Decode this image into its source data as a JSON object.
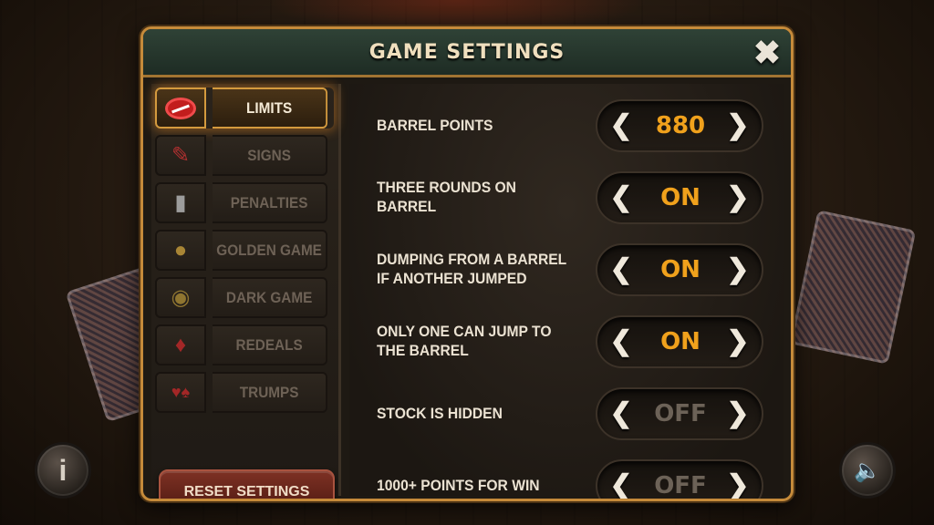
{
  "dialog": {
    "title": "GAME SETTINGS"
  },
  "sidebar": {
    "items": [
      {
        "label": "LIMITS",
        "icon": "no-entry-icon",
        "active": true
      },
      {
        "label": "SIGNS",
        "icon": "pen-icon",
        "active": false
      },
      {
        "label": "PENALTIES",
        "icon": "whistle-icon",
        "active": false
      },
      {
        "label": "GOLDEN GAME",
        "icon": "golden-chicken-icon",
        "active": false
      },
      {
        "label": "DARK GAME",
        "icon": "mask-icon",
        "active": false
      },
      {
        "label": "REDEALS",
        "icon": "cards-icon",
        "active": false
      },
      {
        "label": "TRUMPS",
        "icon": "card-suits-icon",
        "active": false
      }
    ],
    "reset_label": "RESET SETTINGS"
  },
  "settings": [
    {
      "label": "BARREL POINTS",
      "value": "880",
      "state": "on"
    },
    {
      "label": "THREE ROUNDS ON BARREL",
      "value": "ON",
      "state": "on"
    },
    {
      "label": "DUMPING FROM A BARREL IF ANOTHER JUMPED",
      "value": "ON",
      "state": "on"
    },
    {
      "label": "ONLY ONE CAN JUMP TO THE BARREL",
      "value": "ON",
      "state": "on"
    },
    {
      "label": "STOCK IS HIDDEN",
      "value": "OFF",
      "state": "off"
    },
    {
      "label": "1000+ POINTS FOR WIN",
      "value": "OFF",
      "state": "off"
    }
  ],
  "colors": {
    "accent": "#f0a11c",
    "frame": "#c58a3a",
    "header": "#2f4236",
    "reset_button": "#7e3124"
  }
}
